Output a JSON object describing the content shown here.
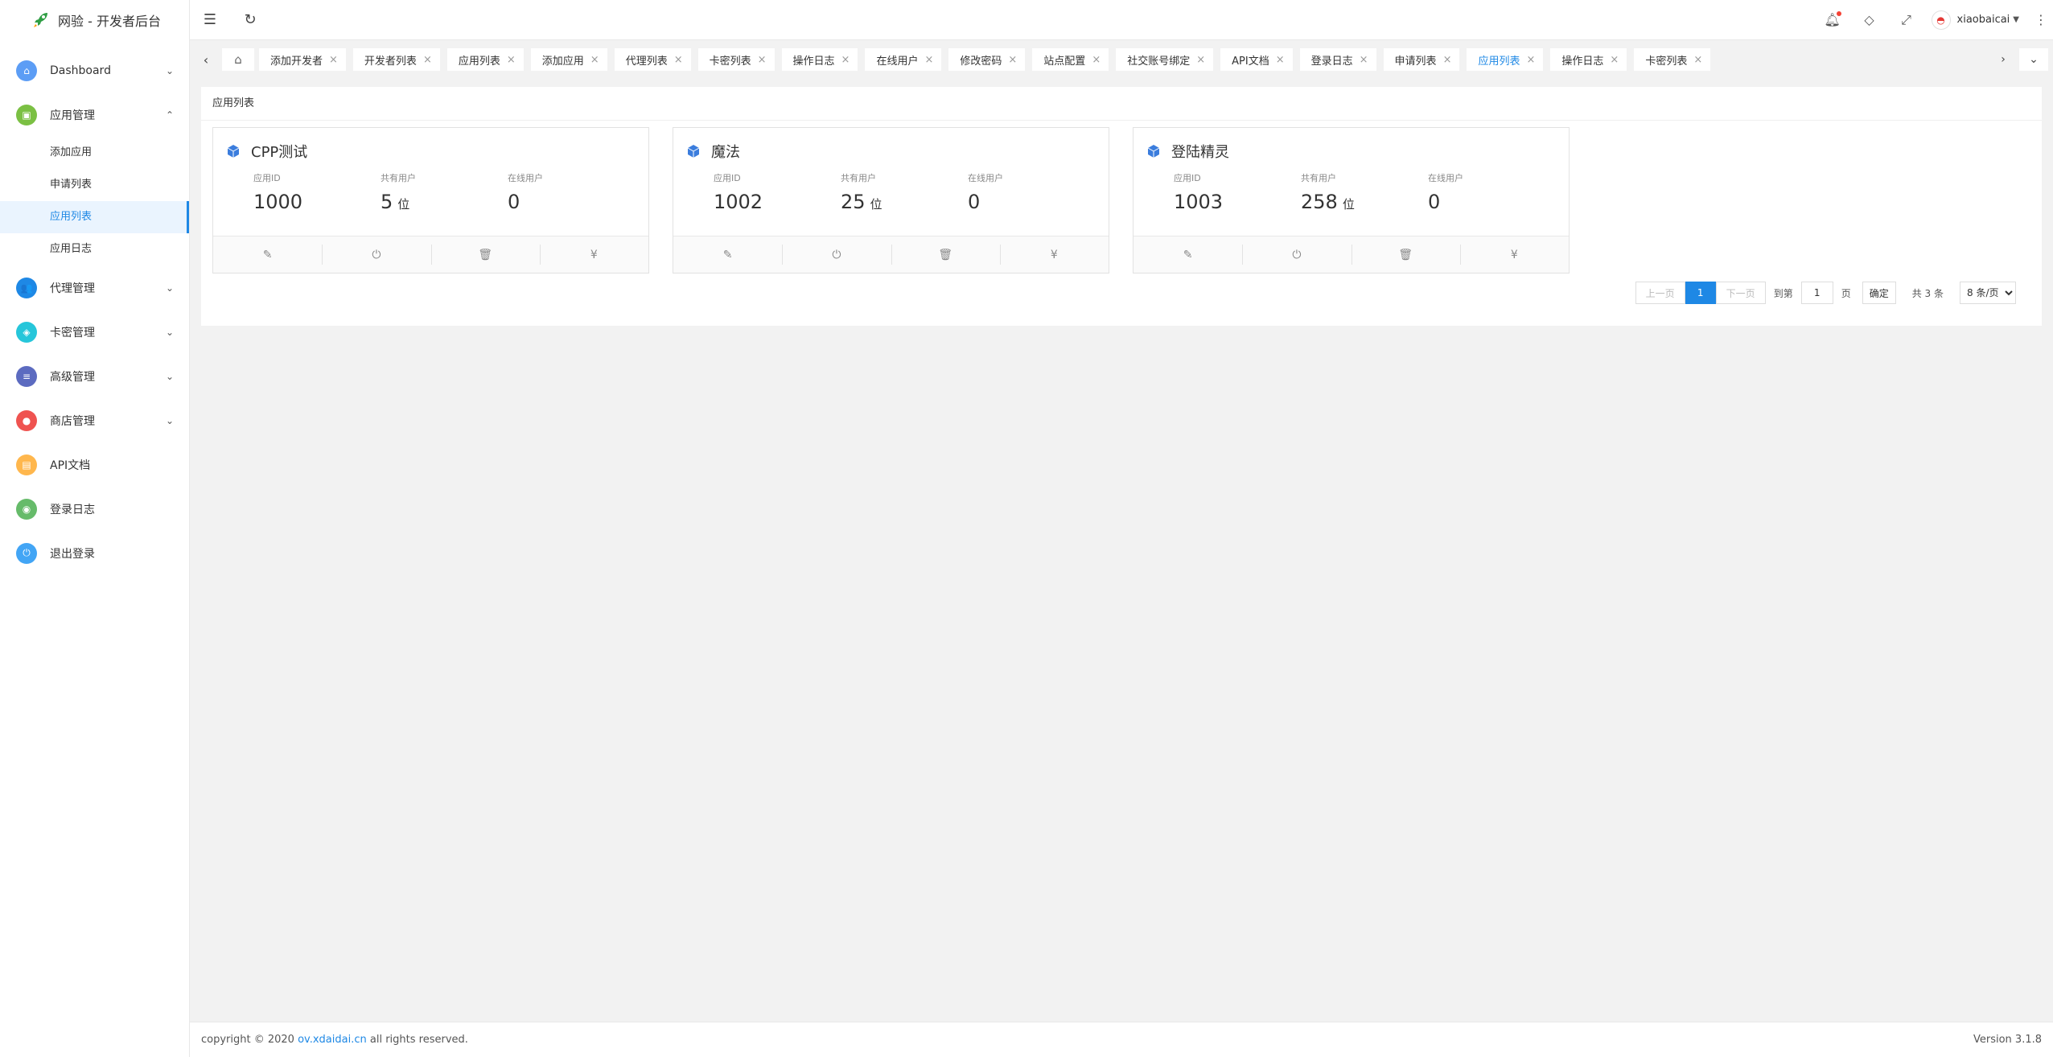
{
  "app": {
    "title": "网验 - 开发者后台"
  },
  "sidebar": {
    "items": [
      {
        "label": "Dashboard",
        "icon": "home-icon",
        "color": "#5c9df5",
        "expanded": false
      },
      {
        "label": "应用管理",
        "icon": "app-icon",
        "color": "#7bc043",
        "expanded": true,
        "children": [
          {
            "label": "添加应用"
          },
          {
            "label": "申请列表"
          },
          {
            "label": "应用列表",
            "active": true
          },
          {
            "label": "应用日志"
          }
        ]
      },
      {
        "label": "代理管理",
        "icon": "users-icon",
        "color": "#1e88e5",
        "expanded": false
      },
      {
        "label": "卡密管理",
        "icon": "card-icon",
        "color": "#26c6da",
        "expanded": false
      },
      {
        "label": "高级管理",
        "icon": "sliders-icon",
        "color": "#5c6bc0",
        "expanded": false
      },
      {
        "label": "商店管理",
        "icon": "store-icon",
        "color": "#ef5350",
        "expanded": false
      },
      {
        "label": "API文档",
        "icon": "doc-icon",
        "color": "#ffb74d"
      },
      {
        "label": "登录日志",
        "icon": "log-icon",
        "color": "#66bb6a"
      },
      {
        "label": "退出登录",
        "icon": "logout-icon",
        "color": "#42a5f5"
      }
    ]
  },
  "header": {
    "username": "xiaobaicai"
  },
  "tabs": [
    {
      "label": "添加开发者"
    },
    {
      "label": "开发者列表"
    },
    {
      "label": "应用列表"
    },
    {
      "label": "添加应用"
    },
    {
      "label": "代理列表"
    },
    {
      "label": "卡密列表"
    },
    {
      "label": "操作日志"
    },
    {
      "label": "在线用户"
    },
    {
      "label": "修改密码"
    },
    {
      "label": "站点配置"
    },
    {
      "label": "社交账号绑定"
    },
    {
      "label": "API文档"
    },
    {
      "label": "登录日志"
    },
    {
      "label": "申请列表"
    },
    {
      "label": "应用列表",
      "active": true
    },
    {
      "label": "操作日志"
    },
    {
      "label": "卡密列表"
    }
  ],
  "main": {
    "breadcrumb": "应用列表",
    "stat_labels": {
      "app_id": "应用ID",
      "total_users": "共有用户",
      "online_users": "在线用户"
    },
    "user_unit": "位",
    "cards": [
      {
        "name": "CPP测试",
        "app_id": "1000",
        "total_users": "5",
        "online_users": "0"
      },
      {
        "name": "魔法",
        "app_id": "1002",
        "total_users": "25",
        "online_users": "0"
      },
      {
        "name": "登陆精灵",
        "app_id": "1003",
        "total_users": "258",
        "online_users": "0"
      }
    ]
  },
  "pagination": {
    "prev": "上一页",
    "current": "1",
    "next": "下一页",
    "goto_label": "到第",
    "goto_value": "1",
    "page_unit": "页",
    "confirm": "确定",
    "total": "共 3 条",
    "page_size": "8 条/页"
  },
  "footer": {
    "copyright_prefix": "copyright © 2020",
    "link": "ov.xdaidai.cn",
    "copyright_suffix": "all rights reserved.",
    "version": "Version 3.1.8"
  }
}
